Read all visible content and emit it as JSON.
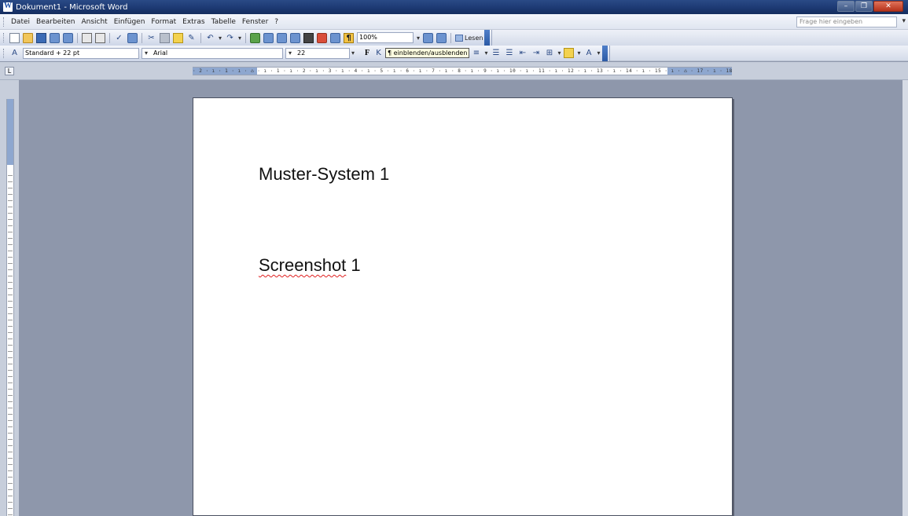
{
  "window": {
    "title": "Dokument1 - Microsoft Word",
    "buttons": {
      "minimize": "–",
      "restore": "❐",
      "close": "✕"
    }
  },
  "menu": {
    "items": [
      "Datei",
      "Bearbeiten",
      "Ansicht",
      "Einfügen",
      "Format",
      "Extras",
      "Tabelle",
      "Fenster",
      "?"
    ],
    "help_placeholder": "Frage hier eingeben"
  },
  "toolbar_standard": {
    "zoom": "100%",
    "read_label": "Lesen"
  },
  "toolbar_format": {
    "style": "Standard + 22 pt",
    "font": "Arial",
    "size": "22",
    "bold_label": "F",
    "tooltip": "¶ einblenden/ausblenden"
  },
  "ruler": {
    "numbers": "· 2 · ı · 1 · ı · ⌂ · ı · 1 · ı · 2 · ı · 3 · ı · 4 · ı · 5 · ı · 6 · ı · 7 · ı · 8 · ı · 9 · ı · 10 · ı · 11 · ı · 12 · ı · 13 · ı · 14 · ı · 15 · ı · ⌂ · 17 · ı · 18 ·"
  },
  "document": {
    "line1": "Muster-System 1",
    "line2_word": "Screenshot",
    "line2_rest": " 1"
  }
}
